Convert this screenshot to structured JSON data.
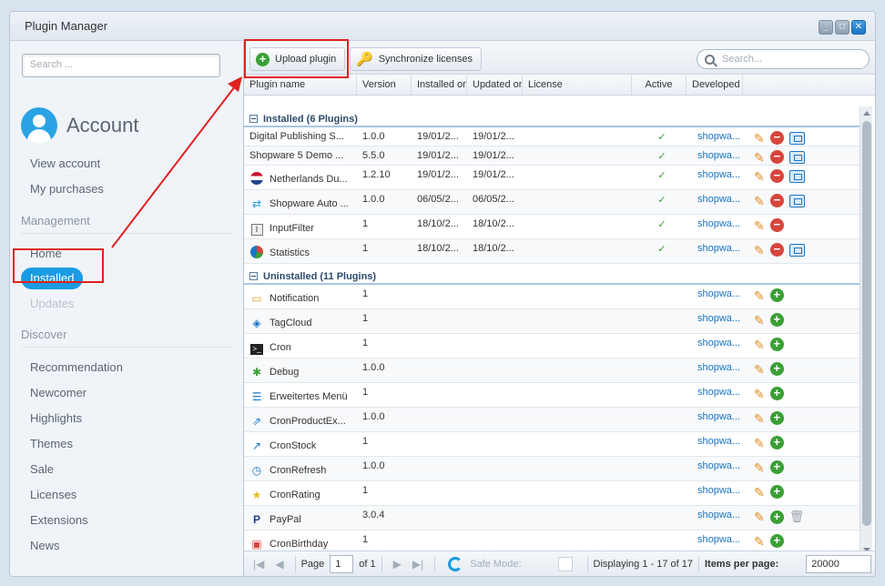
{
  "window": {
    "title": "Plugin Manager",
    "buttons": [
      "min",
      "max",
      "close"
    ]
  },
  "sidebar": {
    "search_placeholder": "Search ...",
    "account_title": "Account",
    "account_links": [
      "View account",
      "My purchases"
    ],
    "management_label": "Management",
    "management_items": [
      {
        "label": "Home",
        "state": "normal"
      },
      {
        "label": "Installed",
        "state": "active"
      },
      {
        "label": "Updates",
        "state": "disabled"
      }
    ],
    "discover_label": "Discover",
    "discover_items": [
      "Recommendation",
      "Newcomer",
      "Highlights",
      "Themes",
      "Sale",
      "Licenses",
      "Extensions",
      "News"
    ]
  },
  "toolbar": {
    "upload_label": "Upload plugin",
    "sync_label": "Synchronize licenses",
    "search_placeholder": "Search..."
  },
  "grid": {
    "columns": [
      "Plugin name",
      "Version",
      "Installed or",
      "Updated or",
      "License",
      "Active",
      "Developed"
    ],
    "installed_group": "Installed (6 Plugins)",
    "installed": [
      {
        "icon": "none",
        "name": "Digital Publishing S...",
        "version": "1.0.0",
        "installed": "19/01/2...",
        "updated": "19/01/2...",
        "active": "✓",
        "dev": "shopwa...",
        "actions": [
          "edit",
          "delete",
          "update"
        ]
      },
      {
        "icon": "none",
        "name": "Shopware 5 Demo ...",
        "version": "5.5.0",
        "installed": "19/01/2...",
        "updated": "19/01/2...",
        "active": "✓",
        "dev": "shopwa...",
        "actions": [
          "edit",
          "delete",
          "update"
        ]
      },
      {
        "icon": "netherlands-flag-icon",
        "name": "Netherlands Du...",
        "version": "1.2.10",
        "installed": "19/01/2...",
        "updated": "19/01/2...",
        "active": "✓",
        "dev": "shopwa...",
        "actions": [
          "edit",
          "delete",
          "update"
        ]
      },
      {
        "icon": "sync-arrows-icon",
        "name": "Shopware Auto ...",
        "version": "1.0.0",
        "installed": "06/05/2...",
        "updated": "06/05/2...",
        "active": "✓",
        "dev": "shopwa...",
        "actions": [
          "edit",
          "delete",
          "update"
        ]
      },
      {
        "icon": "input-filter-icon",
        "name": "InputFilter",
        "version": "1",
        "installed": "18/10/2...",
        "updated": "18/10/2...",
        "active": "✓",
        "dev": "shopwa...",
        "actions": [
          "edit",
          "delete"
        ]
      },
      {
        "icon": "pie-chart-icon",
        "name": "Statistics",
        "version": "1",
        "installed": "18/10/2...",
        "updated": "18/10/2...",
        "active": "✓",
        "dev": "shopwa...",
        "actions": [
          "edit",
          "delete",
          "update"
        ]
      }
    ],
    "uninstalled_group": "Uninstalled (11 Plugins)",
    "uninstalled": [
      {
        "icon": "notification-icon",
        "name": "Notification",
        "version": "1",
        "dev": "shopwa...",
        "actions": [
          "edit",
          "install"
        ]
      },
      {
        "icon": "tag-icon",
        "name": "TagCloud",
        "version": "1",
        "dev": "shopwa...",
        "actions": [
          "edit",
          "install"
        ]
      },
      {
        "icon": "terminal-icon",
        "name": "Cron",
        "version": "1",
        "dev": "shopwa...",
        "actions": [
          "edit",
          "install"
        ]
      },
      {
        "icon": "bug-icon",
        "name": "Debug",
        "version": "1.0.0",
        "dev": "shopwa...",
        "actions": [
          "edit",
          "install"
        ]
      },
      {
        "icon": "menu-icon",
        "name": "Erweitertes Menü",
        "version": "1",
        "dev": "shopwa...",
        "actions": [
          "edit",
          "install"
        ]
      },
      {
        "icon": "export-icon",
        "name": "CronProductEx...",
        "version": "1.0.0",
        "dev": "shopwa...",
        "actions": [
          "edit",
          "install"
        ]
      },
      {
        "icon": "trend-icon",
        "name": "CronStock",
        "version": "1",
        "dev": "shopwa...",
        "actions": [
          "edit",
          "install"
        ]
      },
      {
        "icon": "clock-icon",
        "name": "CronRefresh",
        "version": "1.0.0",
        "dev": "shopwa...",
        "actions": [
          "edit",
          "install"
        ]
      },
      {
        "icon": "star-icon",
        "name": "CronRating",
        "version": "1",
        "dev": "shopwa...",
        "actions": [
          "edit",
          "install"
        ]
      },
      {
        "icon": "paypal-icon",
        "name": "PayPal",
        "version": "3.0.4",
        "dev": "shopwa...",
        "actions": [
          "edit",
          "install",
          "trash"
        ]
      },
      {
        "icon": "gift-icon",
        "name": "CronBirthday",
        "version": "1",
        "dev": "shopwa...",
        "actions": [
          "edit",
          "install"
        ]
      }
    ]
  },
  "pager": {
    "page_label": "Page",
    "page_value": "1",
    "of_label": "of 1",
    "safe_mode_label": "Safe Mode:",
    "displaying": "Displaying 1 - 17 of 17",
    "items_per_page_label": "Items per page:",
    "items_per_page_value": "20000"
  },
  "colors": {
    "accent": "#1a9be3",
    "annotation": "#e02020"
  }
}
